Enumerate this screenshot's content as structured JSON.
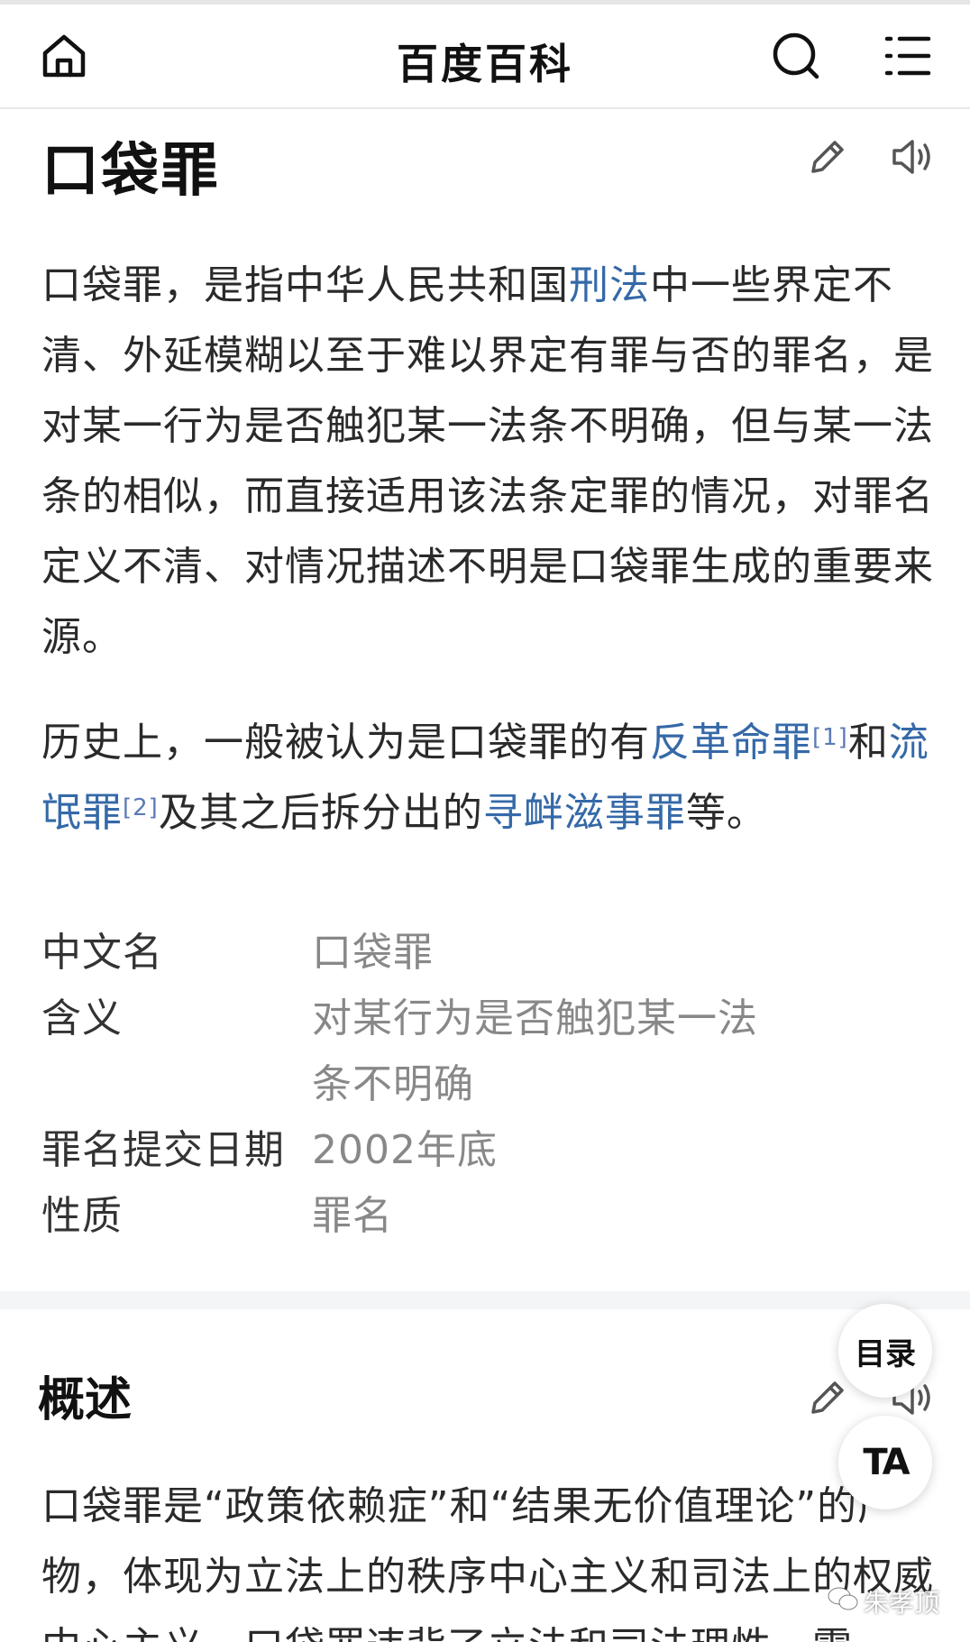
{
  "header": {
    "brand": "百度百科",
    "icons": [
      "home-icon",
      "search-icon",
      "menu-icon"
    ]
  },
  "article": {
    "title": "口袋罪",
    "paragraph1": {
      "before_link": "口袋罪，是指中华人民共和国",
      "link": "刑法",
      "after_link": "中一些界定不清、外延模糊以至于难以界定有罪与否的罪名，是对某一行为是否触犯某一法条不明确，但与某一法条的相似，而直接适用该法条定罪的情况，对罪名定义不清、对情况描述不明是口袋罪生成的重要来源。"
    },
    "paragraph2": {
      "part1": "历史上，一般被认为是口袋罪的有",
      "link1": "反革命罪",
      "ref1": "[1]",
      "part2": "和",
      "link2": "流氓罪",
      "ref2": "[2]",
      "part3": "及其之后拆分出的",
      "link3": "寻衅滋事罪",
      "part4": "等。"
    }
  },
  "infobox": {
    "rows": [
      {
        "label": "中文名",
        "value": "口袋罪"
      },
      {
        "label": "含义",
        "value": "对某行为是否触犯某一法条不明确"
      },
      {
        "label": "罪名提交日期",
        "value": "2002年底"
      },
      {
        "label": "性质",
        "value": "罪名"
      }
    ]
  },
  "section": {
    "title": "概述",
    "text": "口袋罪是“政策依赖症”和“结果无价值理论”的产物，体现为立法上的秩序中心主义和司法上的权威中心主义，口袋罪违背了立法和司法理性，需"
  },
  "floating": {
    "toc_label": "目录",
    "font_label": "TA"
  },
  "watermark": {
    "text": "朱孝顶",
    "icon": "wechat-icon"
  },
  "colors": {
    "link": "#3569a8",
    "value_gray": "#888888",
    "text": "#2a2a2a"
  }
}
